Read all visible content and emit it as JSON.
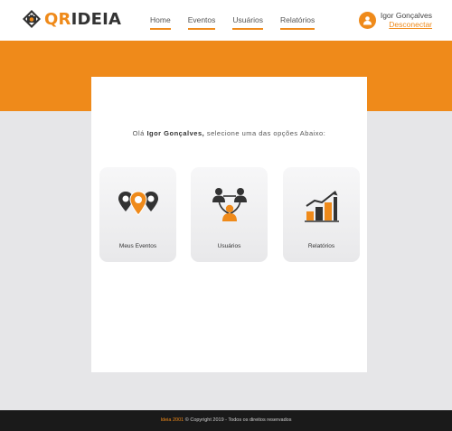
{
  "header": {
    "logo": {
      "part1": "QR",
      "part2": "IDEIA"
    },
    "nav": [
      "Home",
      "Eventos",
      "Usuários",
      "Relatórios"
    ],
    "user": {
      "name": "Igor Gonçalves",
      "logout": "Desconectar"
    }
  },
  "main": {
    "greeting_prefix": "Olá",
    "greeting_name": "Igor Gonçalves,",
    "greeting_suffix": "selecione uma das opções Abaixo:",
    "options": [
      {
        "label": "Meus Eventos",
        "icon": "location-pins-icon"
      },
      {
        "label": "Usuários",
        "icon": "users-network-icon"
      },
      {
        "label": "Relatórios",
        "icon": "bar-chart-growth-icon"
      }
    ]
  },
  "footer": {
    "brand": "Ideia 2001",
    "text": "© Copyright 2019 - Todos os direitos reservados"
  },
  "colors": {
    "accent": "#ef8a1a",
    "dark": "#333333",
    "footer": "#1a1a1a",
    "background": "#e6e6e8"
  }
}
